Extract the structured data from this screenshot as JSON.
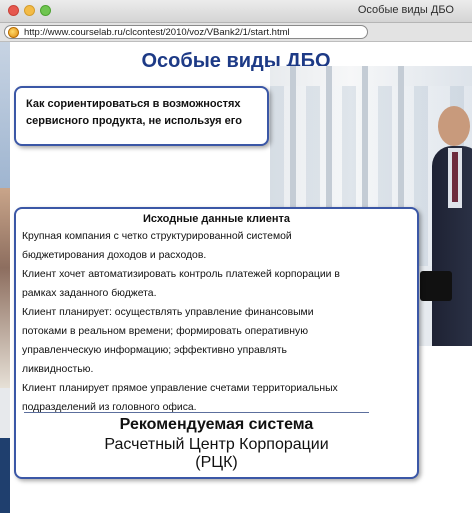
{
  "window": {
    "title": "Особые виды ДБО"
  },
  "browser": {
    "url": "http://www.courselab.ru/clcontest/2010/voz/VBank2/1/start.html"
  },
  "page": {
    "title": "Особые виды ДБО",
    "question": "Как сориентироваться в возможностях сервисного продукта, не используя его",
    "client": {
      "heading": "Исходные данные клиента",
      "paragraphs": [
        "Крупная компания с четко структурированной системой\nбюджетирования доходов и расходов.",
        "Клиент хочет автоматизировать контроль платежей корпорации в\nрамках заданного бюджета.",
        "Клиент планирует: осуществлять управление финансовыми\nпотоками в реальном времени; формировать оперативную\nуправленческую информацию; эффективно управлять\nликвидностью.",
        "Клиент планирует прямое управление счетами территориальных\nподразделений из головного офиса."
      ]
    },
    "recommendation": {
      "title": "Рекомендуемая система",
      "system": "Расчетный Центр Корпорации\n(РЦК)"
    }
  }
}
